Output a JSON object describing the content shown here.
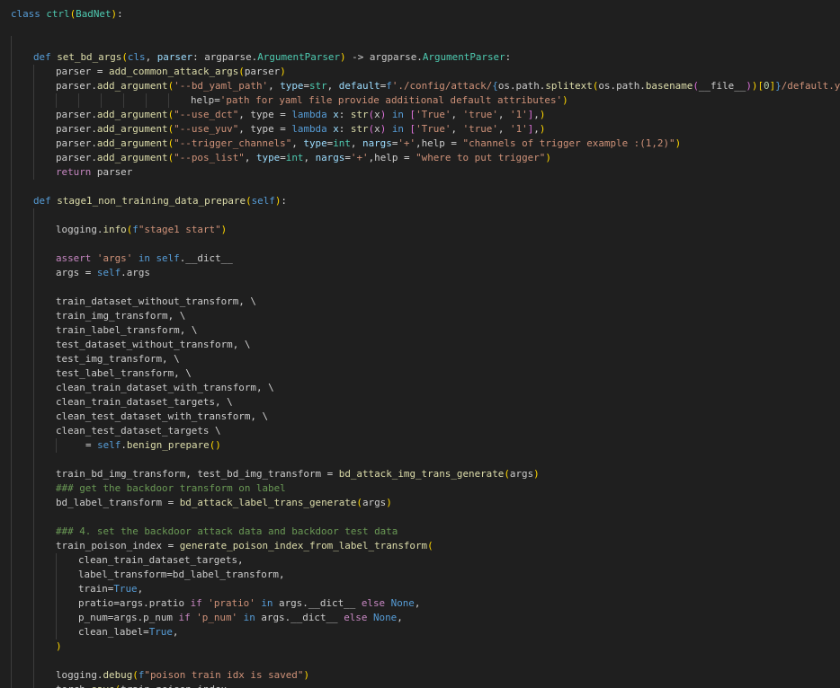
{
  "editor": {
    "language": "python",
    "lines": [
      {
        "indent": 0,
        "text": "class ctrl(BadNet):"
      },
      {
        "indent": 0,
        "text": ""
      },
      {
        "indent": 1,
        "text": ""
      },
      {
        "indent": 1,
        "text": "def set_bd_args(cls, parser: argparse.ArgumentParser) -> argparse.ArgumentParser:"
      },
      {
        "indent": 2,
        "text": "parser = add_common_attack_args(parser)"
      },
      {
        "indent": 2,
        "text": "parser.add_argument('--bd_yaml_path', type=str, default=f'./config/attack/{os.path.splitext(os.path.basename(__file__))[0]}/default.yaml',"
      },
      {
        "indent": 8,
        "text": "help='path for yaml file provide additional default attributes')"
      },
      {
        "indent": 2,
        "text": "parser.add_argument(\"--use_dct\", type = lambda x: str(x) in ['True', 'true', '1'],)"
      },
      {
        "indent": 2,
        "text": "parser.add_argument(\"--use_yuv\", type = lambda x: str(x) in ['True', 'true', '1'],)"
      },
      {
        "indent": 2,
        "text": "parser.add_argument(\"--trigger_channels\", type=int, nargs='+',help = \"channels of trigger example :(1,2)\")"
      },
      {
        "indent": 2,
        "text": "parser.add_argument(\"--pos_list\", type=int, nargs='+',help = \"where to put trigger\")"
      },
      {
        "indent": 2,
        "text": "return parser"
      },
      {
        "indent": 1,
        "text": ""
      },
      {
        "indent": 1,
        "text": "def stage1_non_training_data_prepare(self):"
      },
      {
        "indent": 2,
        "text": ""
      },
      {
        "indent": 2,
        "text": "logging.info(f\"stage1 start\")"
      },
      {
        "indent": 2,
        "text": ""
      },
      {
        "indent": 2,
        "text": "assert 'args' in self.__dict__"
      },
      {
        "indent": 2,
        "text": "args = self.args"
      },
      {
        "indent": 2,
        "text": ""
      },
      {
        "indent": 2,
        "text": "train_dataset_without_transform, \\"
      },
      {
        "indent": 2,
        "text": "train_img_transform, \\"
      },
      {
        "indent": 2,
        "text": "train_label_transform, \\"
      },
      {
        "indent": 2,
        "text": "test_dataset_without_transform, \\"
      },
      {
        "indent": 2,
        "text": "test_img_transform, \\"
      },
      {
        "indent": 2,
        "text": "test_label_transform, \\"
      },
      {
        "indent": 2,
        "text": "clean_train_dataset_with_transform, \\"
      },
      {
        "indent": 2,
        "text": "clean_train_dataset_targets, \\"
      },
      {
        "indent": 2,
        "text": "clean_test_dataset_with_transform, \\"
      },
      {
        "indent": 2,
        "text": "clean_test_dataset_targets \\"
      },
      {
        "indent": 3,
        "text": "= self.benign_prepare()",
        "offset": 8
      },
      {
        "indent": 2,
        "text": ""
      },
      {
        "indent": 2,
        "text": "train_bd_img_transform, test_bd_img_transform = bd_attack_img_trans_generate(args)"
      },
      {
        "indent": 2,
        "text": "### get the backdoor transform on label"
      },
      {
        "indent": 2,
        "text": "bd_label_transform = bd_attack_label_trans_generate(args)"
      },
      {
        "indent": 2,
        "text": ""
      },
      {
        "indent": 2,
        "text": "### 4. set the backdoor attack data and backdoor test data"
      },
      {
        "indent": 2,
        "text": "train_poison_index = generate_poison_index_from_label_transform("
      },
      {
        "indent": 3,
        "text": "clean_train_dataset_targets,"
      },
      {
        "indent": 3,
        "text": "label_transform=bd_label_transform,"
      },
      {
        "indent": 3,
        "text": "train=True,"
      },
      {
        "indent": 3,
        "text": "pratio=args.pratio if 'pratio' in args.__dict__ else None,"
      },
      {
        "indent": 3,
        "text": "p_num=args.p_num if 'p_num' in args.__dict__ else None,"
      },
      {
        "indent": 3,
        "text": "clean_label=True,"
      },
      {
        "indent": 2,
        "text": ")"
      },
      {
        "indent": 2,
        "text": ""
      },
      {
        "indent": 2,
        "text": "logging.debug(f\"poison train idx is saved\")"
      },
      {
        "indent": 2,
        "text": "torch.save(train_poison_index,"
      }
    ]
  },
  "colors": {
    "background": "#1f1f1f",
    "text": "#cccccc",
    "keyword": "#569cd6",
    "control": "#c586c0",
    "class": "#4ec9b0",
    "function": "#dcdcaa",
    "string": "#ce9178",
    "number": "#b5cea8",
    "parameter": "#9cdcfe",
    "comment": "#6a9955",
    "bracket1": "#ffd700",
    "bracket2": "#da70d6",
    "bracket3": "#179fff"
  }
}
